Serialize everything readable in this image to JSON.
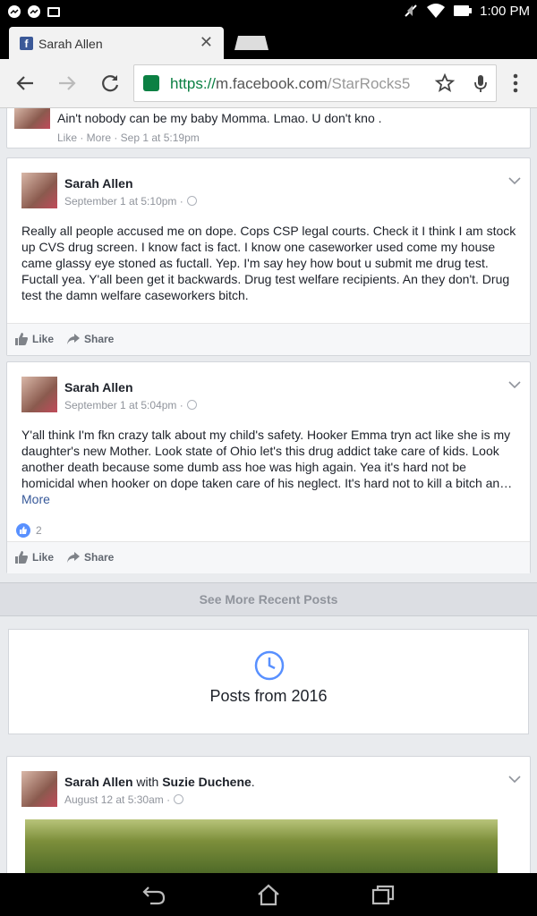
{
  "status_bar": {
    "time": "1:00 PM"
  },
  "browser": {
    "tab_title": "Sarah Allen",
    "url_secure": "https://",
    "url_domain": "m.facebook.com",
    "url_path": "/StarRocks5"
  },
  "feed": {
    "top_post": {
      "text": "Ain't nobody can be my baby Momma. Lmao. U don't kno .",
      "meta": "Like · More · Sep 1 at 5:19pm"
    },
    "posts": [
      {
        "author": "Sarah Allen",
        "timestamp": "September 1 at 5:10pm ·",
        "text": "Really all people accused me on dope. Cops CSP legal courts. Check it I think I am stock up CVS drug screen. I know fact is fact. I know one caseworker used come my house came glassy eye stoned as fuctall. Yep. I'm say hey how bout u submit me drug test. Fuctall yea. Y'all been get it backwards. Drug test welfare recipients. An they don't. Drug test the damn welfare caseworkers bitch.",
        "like_label": "Like",
        "share_label": "Share"
      },
      {
        "author": "Sarah Allen",
        "timestamp": "September 1 at 5:04pm ·",
        "text": "Y'all think I'm fkn crazy talk about my child's safety. Hooker Emma tryn act like she is my daughter's new Mother. Look state of Ohio let's this drug addict take care of kids. Look another death because some dumb ass hoe was high again. Yea it's hard not be homicidal when hooker on dope taken care of his neglect. It's hard not to kill a bitch an…",
        "more_label": "More",
        "like_count": "2",
        "like_label": "Like",
        "share_label": "Share"
      }
    ],
    "see_more_label": "See More Recent Posts",
    "year_section_label": "Posts from 2016",
    "last_post": {
      "author": "Sarah Allen",
      "with_text": "with",
      "tagged": "Suzie Duchene",
      "period": ".",
      "timestamp": "August 12 at 5:30am ·"
    }
  },
  "colors": {
    "facebook_blue": "#3b5998",
    "secure_green": "#0b8043",
    "link_blue": "#365899"
  },
  "icons": [
    "messenger-icon",
    "gallery-icon",
    "mute-icon",
    "wifi-icon",
    "battery-icon",
    "facebook-favicon",
    "close-icon",
    "back-icon",
    "forward-icon",
    "reload-icon",
    "lock-icon",
    "star-icon",
    "mic-icon",
    "menu-icon",
    "chevron-down-icon",
    "like-icon",
    "share-icon",
    "clock-icon",
    "nav-back-icon",
    "nav-home-icon",
    "nav-recents-icon"
  ]
}
